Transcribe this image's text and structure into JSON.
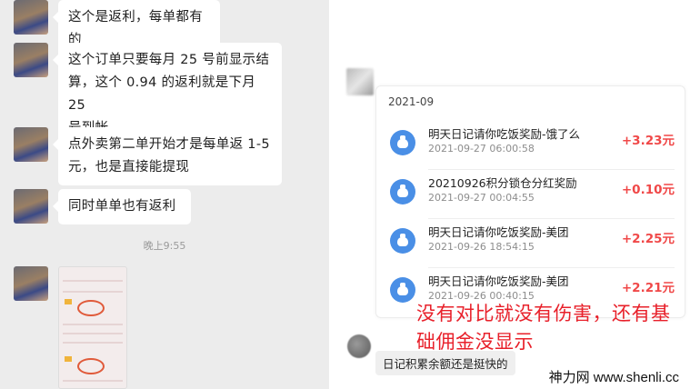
{
  "left_chat": {
    "messages": [
      {
        "text_lines": [
          "这个是返利，每单都有的"
        ]
      },
      {
        "text_lines": [
          "这个订单只要每月 25 号前显示结",
          "算，这个 0.94 的返利就是下月 25",
          "号到帐"
        ]
      },
      {
        "text_lines": [
          "点外卖第二单开始才是每单返 1-5",
          "元，也是直接能提现"
        ]
      },
      {
        "text_lines": [
          "同时单单也有返利"
        ]
      }
    ],
    "timestamp": "晚上9:55"
  },
  "ledger": {
    "month": "2021-09",
    "transactions": [
      {
        "title": "明天日记请你吃饭奖励-饿了么",
        "time": "2021-09-27 06:00:58",
        "amount": "+3.23元",
        "icon": "money-bag-icon"
      },
      {
        "title": "20210926积分锁仓分红奖励",
        "time": "2021-09-27 00:04:55",
        "amount": "+0.10元",
        "icon": "money-bag-icon"
      },
      {
        "title": "明天日记请你吃饭奖励-美团",
        "time": "2021-09-26 18:54:15",
        "amount": "+2.25元",
        "icon": "money-bag-icon"
      },
      {
        "title": "明天日记请你吃饭奖励-美团",
        "time": "2021-09-26 00:40:15",
        "amount": "+2.21元",
        "icon": "money-bag-icon"
      }
    ]
  },
  "overlay_caption": {
    "lines": [
      "没有对比就没有伤害，还有基",
      "础佣金没显示"
    ]
  },
  "reply_bubble": "日记积累余额还是挺快的",
  "watermark": "神力网 www.shenli.cc",
  "colors": {
    "accent_red": "#f04848",
    "icon_blue": "#4a8fe6",
    "caption_red": "#e8202a"
  }
}
